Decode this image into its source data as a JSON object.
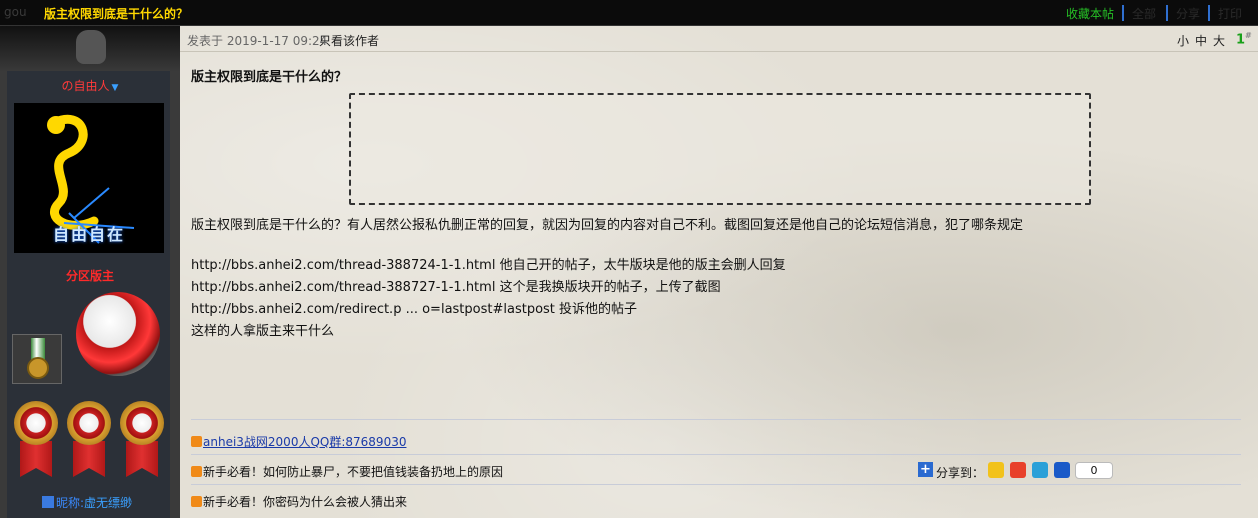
{
  "topbar": {
    "title": "版主权限到底是干什么的？",
    "ghost": "gou",
    "favorite": "收藏本帖",
    "dim_items": [
      "全部",
      "分享",
      "打印"
    ]
  },
  "author": {
    "username": "の自由人",
    "avatar_caption": "自由自在",
    "role": "分区版主",
    "nickname_label": "昵称:",
    "nickname": "虚无缥缈"
  },
  "post": {
    "date": "发表于 2019-1-17 09:24",
    "author_only": "只看该作者",
    "size_small": "小",
    "size_medium": "中",
    "size_large": "大",
    "floor": "1",
    "floor_sup": "#",
    "title": "版主权限到底是干什么的？",
    "lines": [
      "版主权限到底是干什么的？有人居然公报私仇删正常的回复，就因为回复的内容对自己不利。截图回复还是他自己的论坛短信消息，犯了哪条规定",
      "http://bbs.anhei2.com/thread-388724-1-1.html  他自己开的帖子，太牛版块是他的版主会删人回复",
      "http://bbs.anhei2.com/thread-388727-1-1.html  这个是我换版块开的帖子，上传了截图",
      "http://bbs.anhei2.com/redirect.p ... o=lastpost#lastpost  投诉他的帖子",
      "这样的人拿版主来干什么"
    ]
  },
  "signature": {
    "qq_text": "anhei3战网2000人QQ群:",
    "qq_number": "87689030",
    "notice1": "新手必看！如何防止暴尸，不要把值钱装备扔地上的原因",
    "notice2": "新手必看！你密码为什么会被人猜出来"
  },
  "share": {
    "label": "分享到：",
    "count": "0",
    "icons": [
      "qzone-icon",
      "weibo-icon",
      "tencent-weibo-icon",
      "renren-icon"
    ]
  }
}
